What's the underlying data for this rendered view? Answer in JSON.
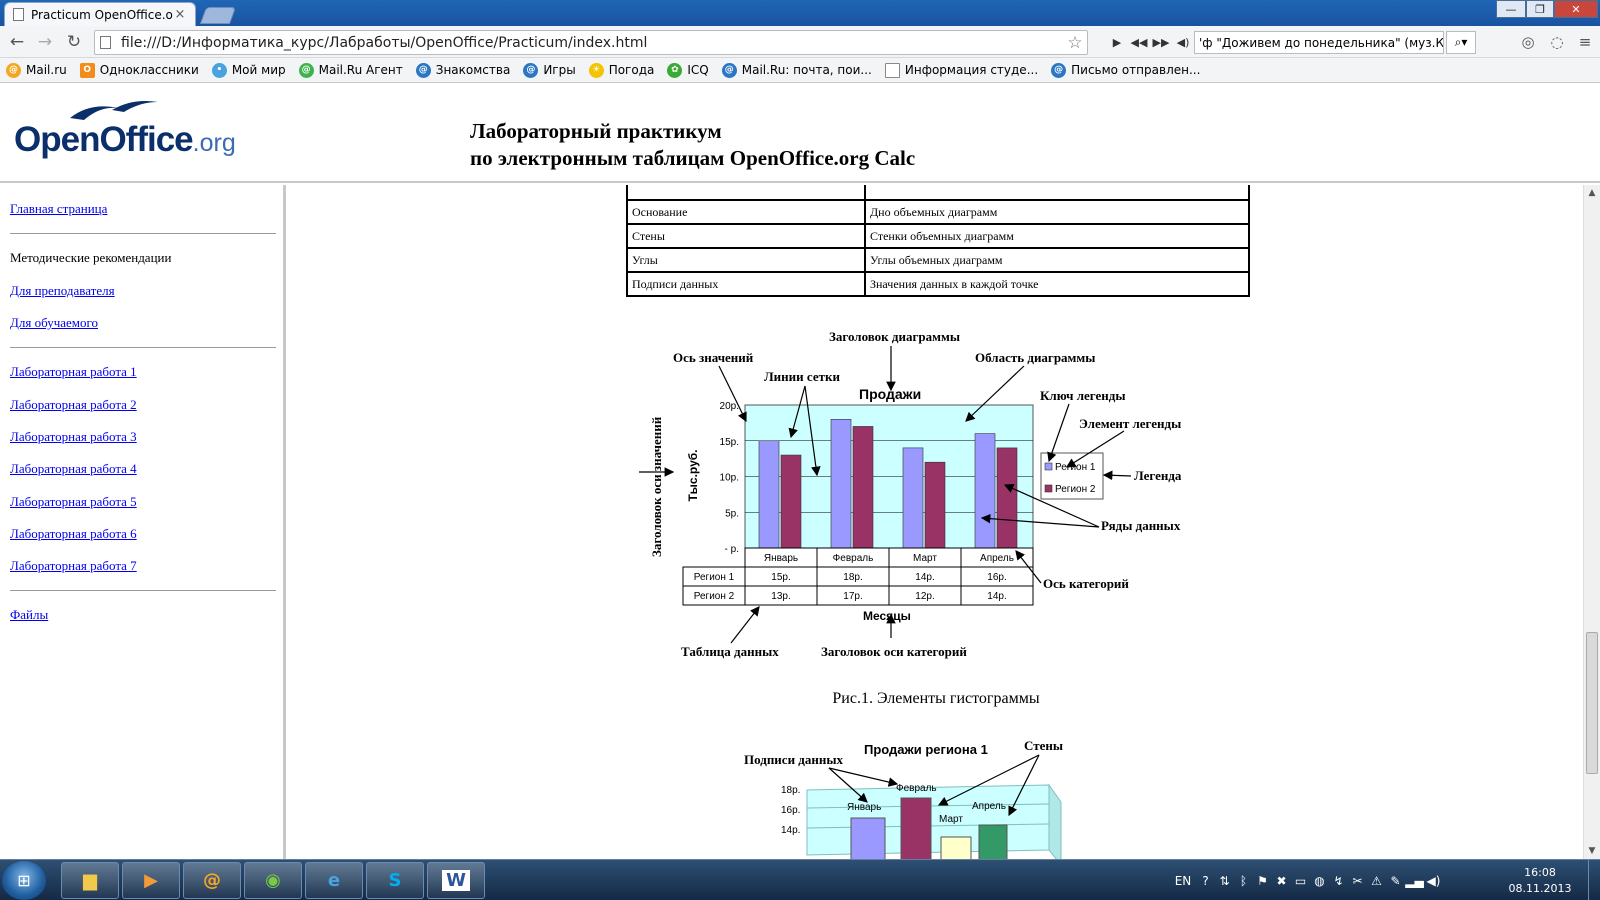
{
  "browser": {
    "tab_title": "Practicum OpenOffice.org",
    "url": "file:///D:/Информатика_курс/Лабработы/OpenOffice/Practicum/index.html",
    "player_track": "'ф \"Доживем до понедельника\" (муз.К.Молч",
    "bookmarks": [
      "Mail.ru",
      "Одноклассники",
      "Мой мир",
      "Mail.Ru Агент",
      "Знакомства",
      "Игры",
      "Погода",
      "ICQ",
      "Mail.Ru: почта, пои...",
      "Информация студе...",
      "Письмо отправлен..."
    ]
  },
  "header": {
    "logo_main": "OpenOffice",
    "logo_suffix": ".org",
    "title_line1": "Лабораторный практикум",
    "title_line2": "по электронным таблицам OpenOffice.org Calc"
  },
  "nav": {
    "home": "Главная страница",
    "methods": "Методические рекомендации",
    "teacher": "Для преподавателя",
    "student": "Для обучаемого",
    "lab1": "Лабораторная работа 1",
    "lab2": "Лабораторная работа 2",
    "lab3": "Лабораторная работа 3",
    "lab4": "Лабораторная работа 4",
    "lab5": "Лабораторная работа 5",
    "lab6": "Лабораторная работа 6",
    "lab7": "Лабораторная работа 7",
    "files": "Файлы"
  },
  "table": [
    {
      "name": "Основание",
      "desc": "Дно объемных диаграмм"
    },
    {
      "name": "Стены",
      "desc": "Стенки объемных диаграмм"
    },
    {
      "name": "Углы",
      "desc": "Углы объемных диаграмм"
    },
    {
      "name": "Подписи данных",
      "desc": "Значения данных в каждой точке"
    }
  ],
  "figure1": {
    "callouts": {
      "chart_title_label": "Заголовок диаграммы",
      "value_axis": "Ось значений",
      "chart_area": "Область диаграммы",
      "grid_lines": "Линии сетки",
      "legend_key": "Ключ легенды",
      "legend_item": "Элемент легенды",
      "legend": "Легенда",
      "value_axis_title": "Заголовок оси значений",
      "data_series": "Ряды данных",
      "category_axis": "Ось категорий",
      "data_table": "Таблица данных",
      "category_axis_title": "Заголовок оси категорий"
    },
    "caption": "Рис.1. Элементы гистограммы"
  },
  "figure2": {
    "title": "Продажи региона 1",
    "data_labels": "Подписи данных",
    "walls": "Стены",
    "y_ticks": [
      "18р.",
      "16р.",
      "14р."
    ],
    "labels": [
      "Январь",
      "Февраль",
      "Март",
      "Апрель"
    ]
  },
  "chart_data": {
    "type": "bar",
    "title": "Продажи",
    "xlabel": "Месяцы",
    "ylabel": "Тыс.руб.",
    "categories": [
      "Январь",
      "Февраль",
      "Март",
      "Апрель"
    ],
    "y_ticks": [
      "20р.",
      "15р.",
      "10р.",
      "5р.",
      "-  р."
    ],
    "ylim": [
      0,
      20
    ],
    "series": [
      {
        "name": "Регион 1",
        "values": [
          15,
          18,
          14,
          16
        ],
        "labels": [
          "15р.",
          "18р.",
          "14р.",
          "16р."
        ],
        "color": "#9999ff"
      },
      {
        "name": "Регион 2",
        "values": [
          13,
          17,
          12,
          14
        ],
        "labels": [
          "13р.",
          "17р.",
          "12р.",
          "14р."
        ],
        "color": "#993366"
      }
    ],
    "plot_background": "#ccffff",
    "grid": true,
    "legend_position": "right"
  },
  "taskbar": {
    "lang": "EN",
    "time": "16:08",
    "date": "08.11.2013"
  }
}
